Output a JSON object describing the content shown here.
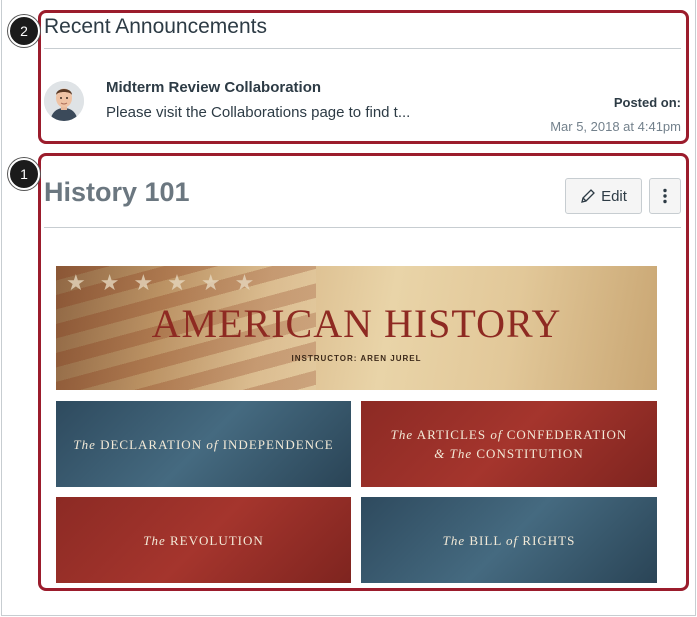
{
  "announcements": {
    "heading": "Recent Announcements",
    "callout_number": "2",
    "item": {
      "title": "Midterm Review Collaboration",
      "preview": "Please visit the Collaborations page to find t...",
      "posted_label": "Posted on:",
      "posted_date": "Mar 5, 2018 at 4:41pm"
    }
  },
  "course": {
    "callout_number": "1",
    "title": "History 101",
    "edit_label": "Edit",
    "banner": {
      "title": "AMERICAN HISTORY",
      "instructor": "INSTRUCTOR: AREN JUREL"
    },
    "tiles": {
      "declaration": {
        "pre": "The",
        "main": "DECLARATION",
        "join": "of",
        "tail": "INDEPENDENCE"
      },
      "articles": {
        "pre": "The",
        "main": "ARTICLES",
        "join": "of",
        "tail": "CONFEDERATION",
        "line2_amp": "&",
        "line2_pre": "The",
        "line2_main": "CONSTITUTION"
      },
      "revolution": {
        "pre": "The",
        "main": "REVOLUTION"
      },
      "bill": {
        "pre": "The",
        "main": "BILL",
        "join": "of",
        "tail": "RIGHTS"
      }
    }
  },
  "colors": {
    "callout_border": "#9b1c2c",
    "banner_red": "#8e2a22",
    "tile_blue": "#2e4a5e",
    "tile_red": "#8c2a24"
  }
}
